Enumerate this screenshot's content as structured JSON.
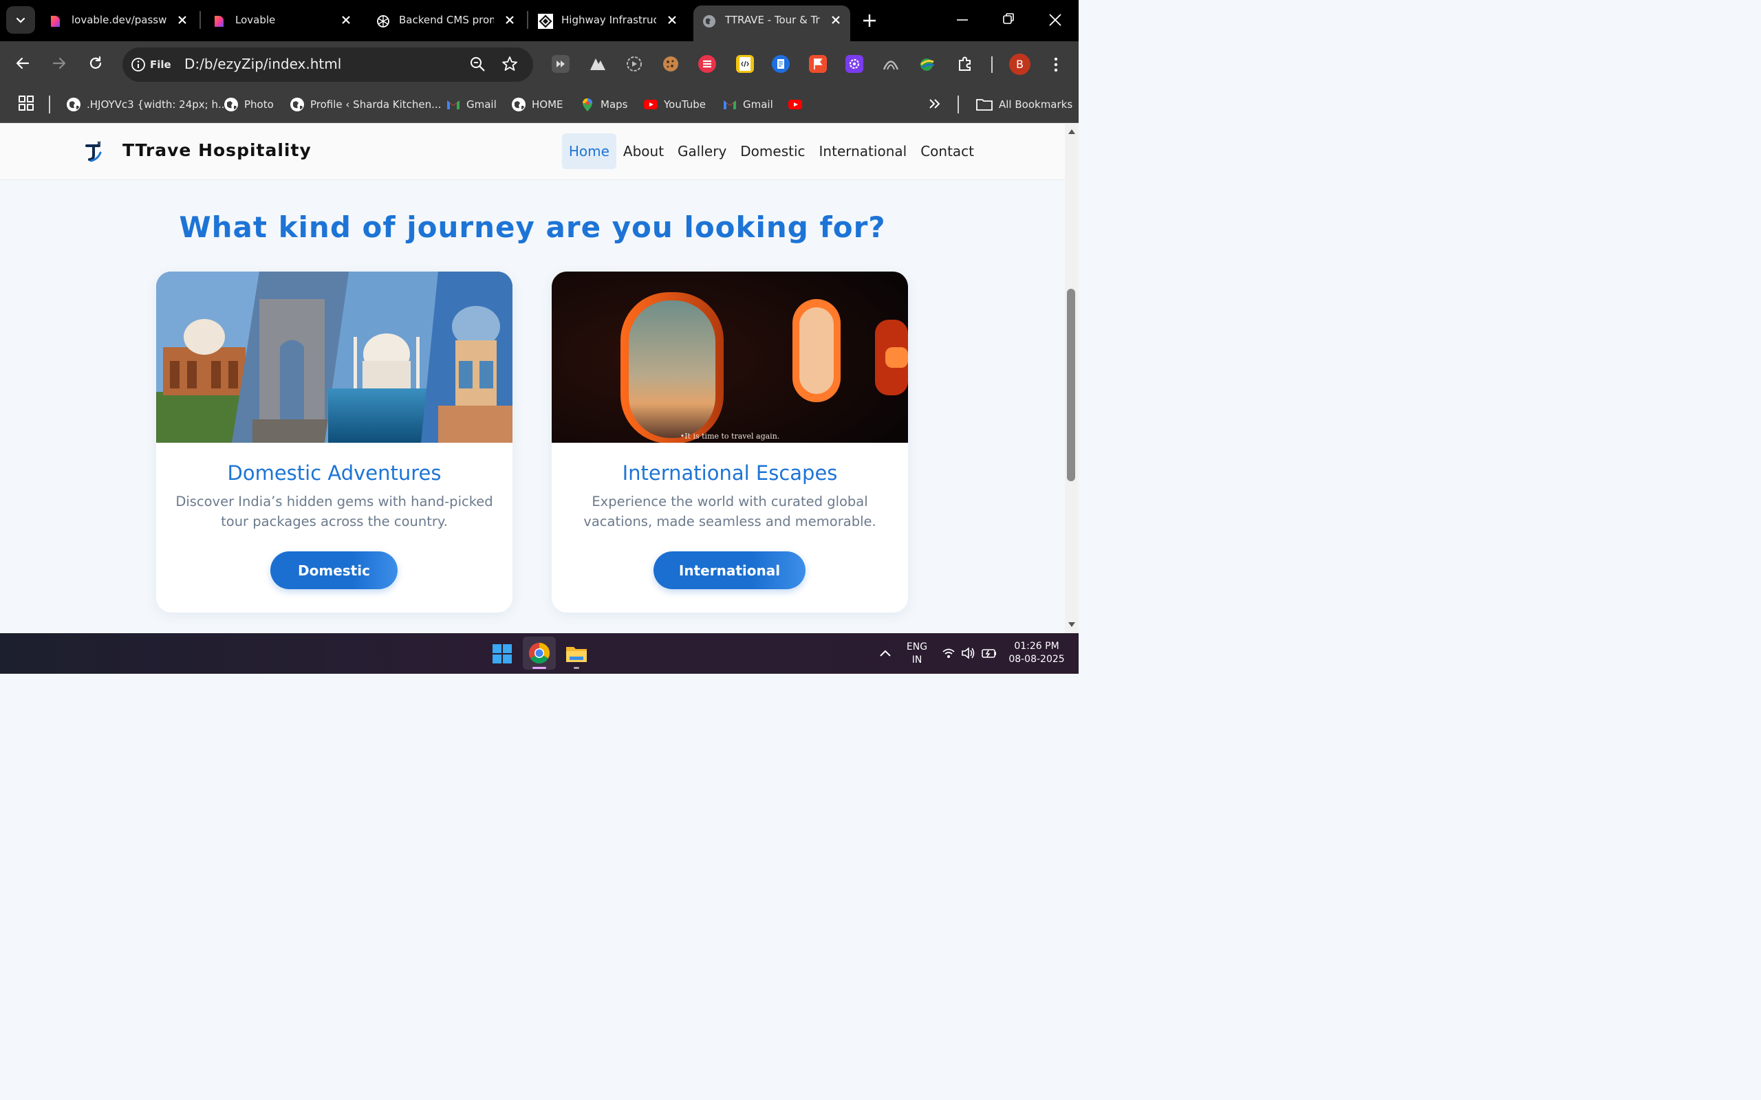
{
  "browser": {
    "tabs": [
      {
        "title": "lovable.dev/password",
        "icon": "lovable-heart-icon",
        "active": false
      },
      {
        "title": "Lovable",
        "icon": "lovable-heart-icon",
        "active": false
      },
      {
        "title": "Backend CMS prompt",
        "icon": "openai-icon",
        "active": false
      },
      {
        "title": "Highway Infrastructure",
        "icon": "diamond-logo-icon",
        "active": false
      },
      {
        "title": "TTRAVE - Tour & Travel",
        "icon": "globe-icon",
        "active": true
      }
    ],
    "omnibox": {
      "scheme_label": "File",
      "url": "D:/b/ezyZip/index.html"
    },
    "profile_initial": "B",
    "bookmarks": [
      {
        "label": ".HJOYVc3 {width: 24px; h...",
        "icon": "globe-icon"
      },
      {
        "label": "Photo",
        "icon": "globe-icon"
      },
      {
        "label": "Profile ‹ Sharda Kitchen...",
        "icon": "globe-icon"
      },
      {
        "label": "Gmail",
        "icon": "gmail-icon"
      },
      {
        "label": "HOME",
        "icon": "globe-icon"
      },
      {
        "label": "Maps",
        "icon": "maps-pin-icon"
      },
      {
        "label": "YouTube",
        "icon": "youtube-icon"
      },
      {
        "label": "Gmail",
        "icon": "gmail-icon"
      },
      {
        "label": "",
        "icon": "youtube-icon"
      }
    ],
    "all_bookmarks_label": "All Bookmarks"
  },
  "site": {
    "brand": "TTrave Hospitality",
    "nav": [
      "Home",
      "About",
      "Gallery",
      "Domestic",
      "International",
      "Contact"
    ],
    "active_nav": "Home",
    "accent_color": "#1d74d6",
    "heading": "What kind of journey are you looking for?",
    "cards": [
      {
        "title": "Domestic Adventures",
        "description": "Discover India’s hidden gems with hand-picked tour packages across the country.",
        "button": "Domestic",
        "image": "india-monuments-collage"
      },
      {
        "title": "International Escapes",
        "description": "Experience the world with curated global vacations, made seamless and memorable.",
        "button": "International",
        "image": "airplane-window-sunset",
        "image_caption": "•It is time to travel again."
      }
    ]
  },
  "taskbar": {
    "lang_line1": "ENG",
    "lang_line2": "IN",
    "time": "01:26 PM",
    "date": "08-08-2025"
  }
}
